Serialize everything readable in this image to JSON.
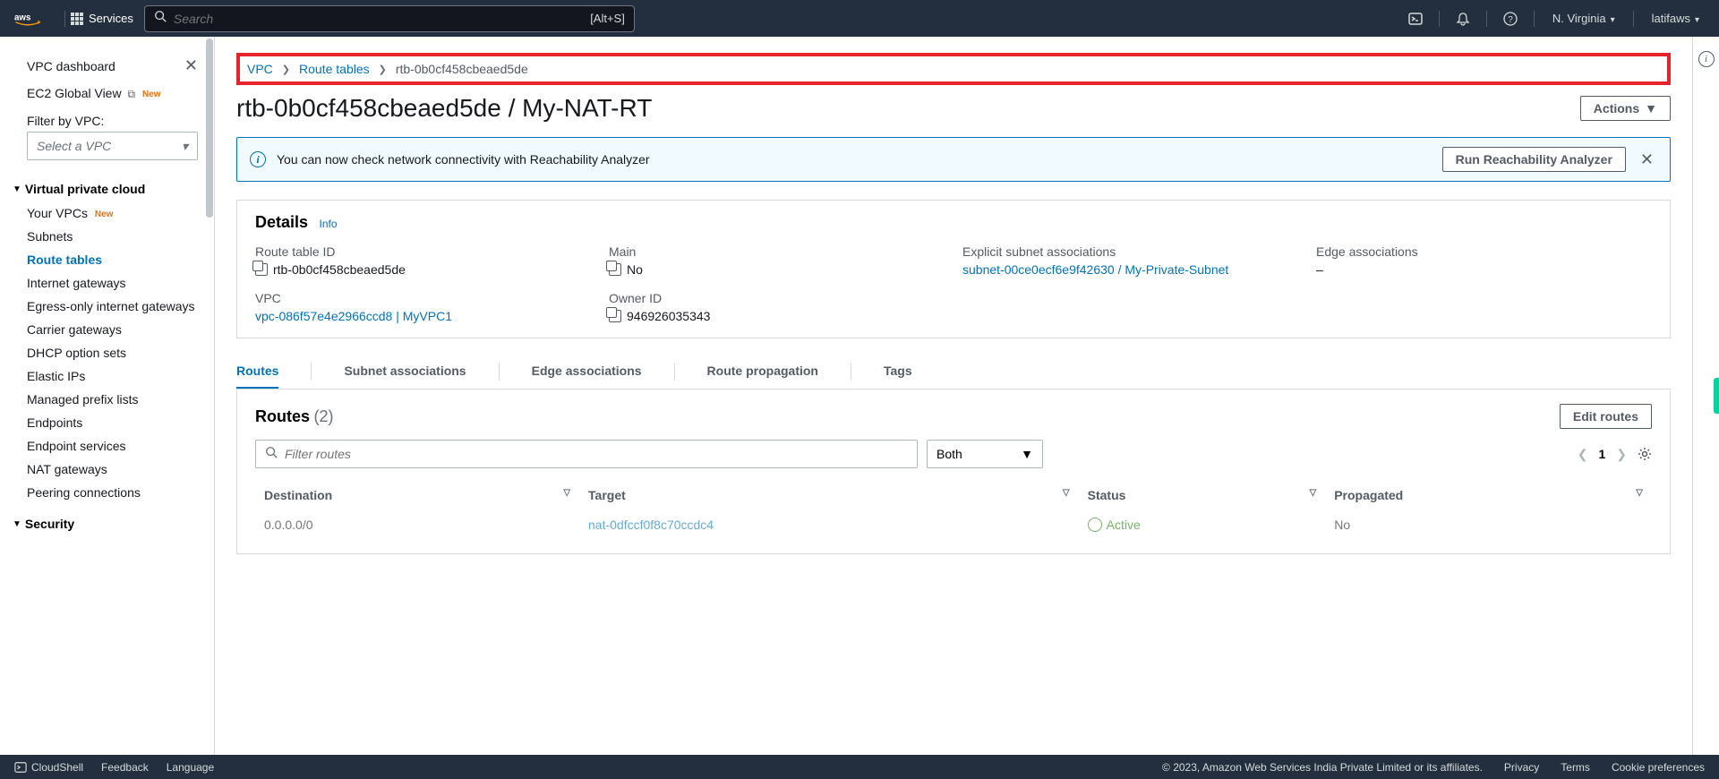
{
  "topbar": {
    "services": "Services",
    "search_placeholder": "Search",
    "search_shortcut": "[Alt+S]",
    "region": "N. Virginia",
    "user": "latifaws"
  },
  "sidebar": {
    "dashboard": "VPC dashboard",
    "ec2_global": "EC2 Global View",
    "new_badge": "New",
    "filter_label": "Filter by VPC:",
    "filter_placeholder": "Select a VPC",
    "section_vpc": "Virtual private cloud",
    "items": {
      "your_vpcs": "Your VPCs",
      "subnets": "Subnets",
      "route_tables": "Route tables",
      "igw": "Internet gateways",
      "egress": "Egress-only internet gateways",
      "carrier": "Carrier gateways",
      "dhcp": "DHCP option sets",
      "eip": "Elastic IPs",
      "prefix": "Managed prefix lists",
      "endpoints": "Endpoints",
      "endpoint_svc": "Endpoint services",
      "nat": "NAT gateways",
      "peering": "Peering connections"
    },
    "section_security": "Security"
  },
  "breadcrumb": {
    "vpc": "VPC",
    "route_tables": "Route tables",
    "current": "rtb-0b0cf458cbeaed5de"
  },
  "page_title": "rtb-0b0cf458cbeaed5de / My-NAT-RT",
  "actions_btn": "Actions",
  "notice": {
    "msg": "You can now check network connectivity with Reachability Analyzer",
    "btn": "Run Reachability Analyzer"
  },
  "details": {
    "heading": "Details",
    "info": "Info",
    "route_table_id_label": "Route table ID",
    "route_table_id": "rtb-0b0cf458cbeaed5de",
    "main_label": "Main",
    "main": "No",
    "explicit_label": "Explicit subnet associations",
    "explicit": "subnet-00ce0ecf6e9f42630 / My-Private-Subnet",
    "edge_label": "Edge associations",
    "edge": "–",
    "vpc_label": "VPC",
    "vpc": "vpc-086f57e4e2966ccd8 | MyVPC1",
    "owner_label": "Owner ID",
    "owner": "946926035343"
  },
  "tabs": {
    "routes": "Routes",
    "subnet": "Subnet associations",
    "edge": "Edge associations",
    "prop": "Route propagation",
    "tags": "Tags"
  },
  "routes": {
    "title": "Routes",
    "count": "(2)",
    "edit_btn": "Edit routes",
    "filter_placeholder": "Filter routes",
    "scope": "Both",
    "page": "1",
    "col_dest": "Destination",
    "col_target": "Target",
    "col_status": "Status",
    "col_prop": "Propagated",
    "rows": [
      {
        "dest": "0.0.0.0/0",
        "target": "nat-0dfccf0f8c70ccdc4",
        "status": "Active",
        "prop": "No"
      }
    ]
  },
  "footer": {
    "cloudshell": "CloudShell",
    "feedback": "Feedback",
    "language": "Language",
    "copyright": "© 2023, Amazon Web Services India Private Limited or its affiliates.",
    "privacy": "Privacy",
    "terms": "Terms",
    "cookies": "Cookie preferences"
  }
}
